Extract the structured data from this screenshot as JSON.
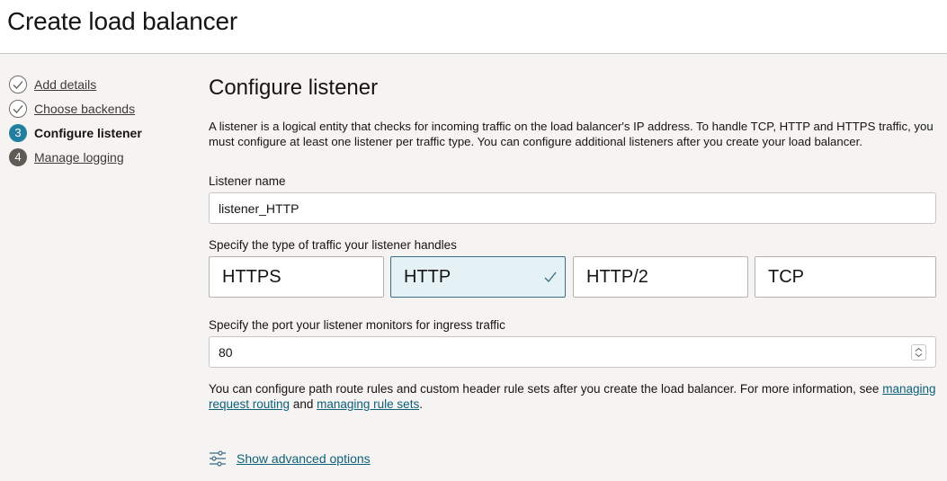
{
  "header": {
    "title": "Create load balancer"
  },
  "steps": [
    {
      "label": "Add details",
      "status": "done",
      "number": "1"
    },
    {
      "label": "Choose backends",
      "status": "done",
      "number": "2"
    },
    {
      "label": "Configure listener",
      "status": "current",
      "number": "3"
    },
    {
      "label": "Manage logging",
      "status": "pending",
      "number": "4"
    }
  ],
  "main": {
    "title": "Configure listener",
    "description": "A listener is a logical entity that checks for incoming traffic on the load balancer's IP address. To handle TCP, HTTP and HTTPS traffic, you must configure at least one listener per traffic type. You can configure additional listeners after you create your load balancer.",
    "listener_name": {
      "label": "Listener name",
      "value": "listener_HTTP"
    },
    "traffic": {
      "label": "Specify the type of traffic your listener handles",
      "options": [
        "HTTPS",
        "HTTP",
        "HTTP/2",
        "TCP"
      ],
      "selected": "HTTP"
    },
    "port": {
      "label": "Specify the port your listener monitors for ingress traffic",
      "value": "80"
    },
    "note": {
      "text_before": "You can configure path route rules and custom header rule sets after you create the load balancer. For more information, see",
      "link1": "managing request routing",
      "and": "and",
      "link2": "managing rule sets",
      "end": "."
    },
    "advanced": {
      "label": "Show advanced options",
      "icon": "sliders-icon"
    }
  },
  "colors": {
    "accent": "#227e9e",
    "selected_bg": "#e4f1f5",
    "link": "#0e5f7a"
  }
}
